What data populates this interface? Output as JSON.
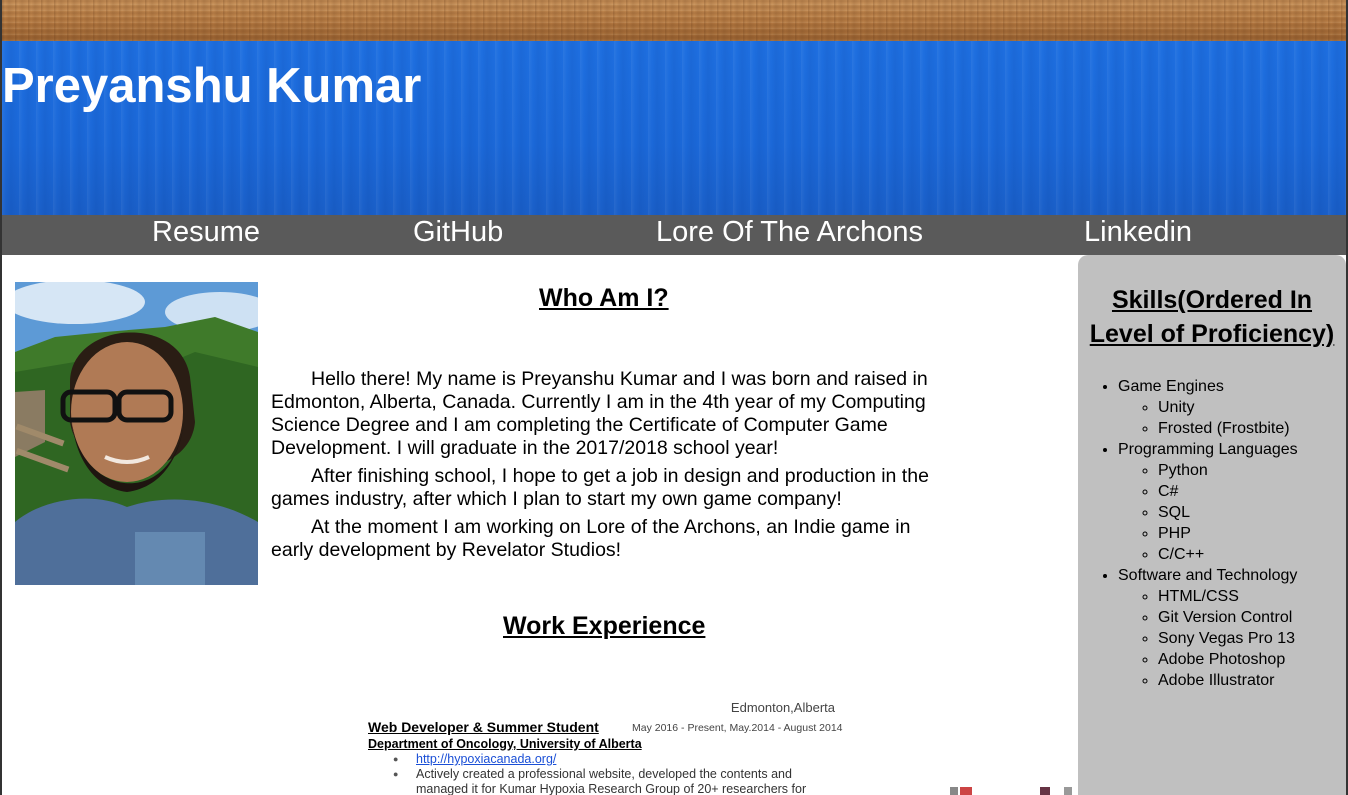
{
  "header": {
    "title": "Preyanshu Kumar"
  },
  "nav": {
    "items": [
      {
        "label": "Resume"
      },
      {
        "label": "GitHub"
      },
      {
        "label": "Lore Of The Archons"
      },
      {
        "label": "Linkedin"
      }
    ]
  },
  "about": {
    "heading": "Who Am I?",
    "paragraphs": [
      "Hello there! My name is Preyanshu Kumar and I was born and raised in Edmonton, Alberta, Canada. Currently I am in the 4th year of my Computing Science Degree and I am completing the Certificate of Computer Game Development. I will graduate in the 2017/2018 school year!",
      "After finishing school, I hope to get a job in design and production in the games industry, after which I plan to start my own game company!",
      "At the moment I am working on Lore of the Archons, an Indie game in early development by Revelator Studios!"
    ]
  },
  "work": {
    "heading": "Work Experience",
    "resume": {
      "location": "Edmonton,Alberta",
      "title": "Web Developer & Summer Student",
      "dates": "May 2016 - Present, May.2014 - August 2014",
      "department": "Department of Oncology, University of Alberta",
      "link": "http://hypoxiacanada.org/",
      "bullet1": "Actively created a professional website, developed the contents and managed it for Kumar Hypoxia Research Group of 20+ researchers for"
    }
  },
  "skills": {
    "heading": "Skills(Ordered In Level of Proficiency)",
    "groups": [
      {
        "name": "Game Engines",
        "items": [
          "Unity",
          "Frosted (Frostbite)"
        ]
      },
      {
        "name": "Programming Languages",
        "items": [
          "Python",
          "C#",
          "SQL",
          "PHP",
          "C/C++"
        ]
      },
      {
        "name": "Software and Technology",
        "items": [
          "HTML/CSS",
          "Git Version Control",
          "Sony Vegas Pro 13",
          "Adobe Photoshop",
          "Adobe Illustrator"
        ]
      }
    ]
  },
  "colors": {
    "banner": "#1e6fe0",
    "nav_bar": "#5a5a5a",
    "skills_panel": "#c0c0c0",
    "wood": "#b77c44"
  },
  "icons": {
    "photo": "profile-photo"
  }
}
